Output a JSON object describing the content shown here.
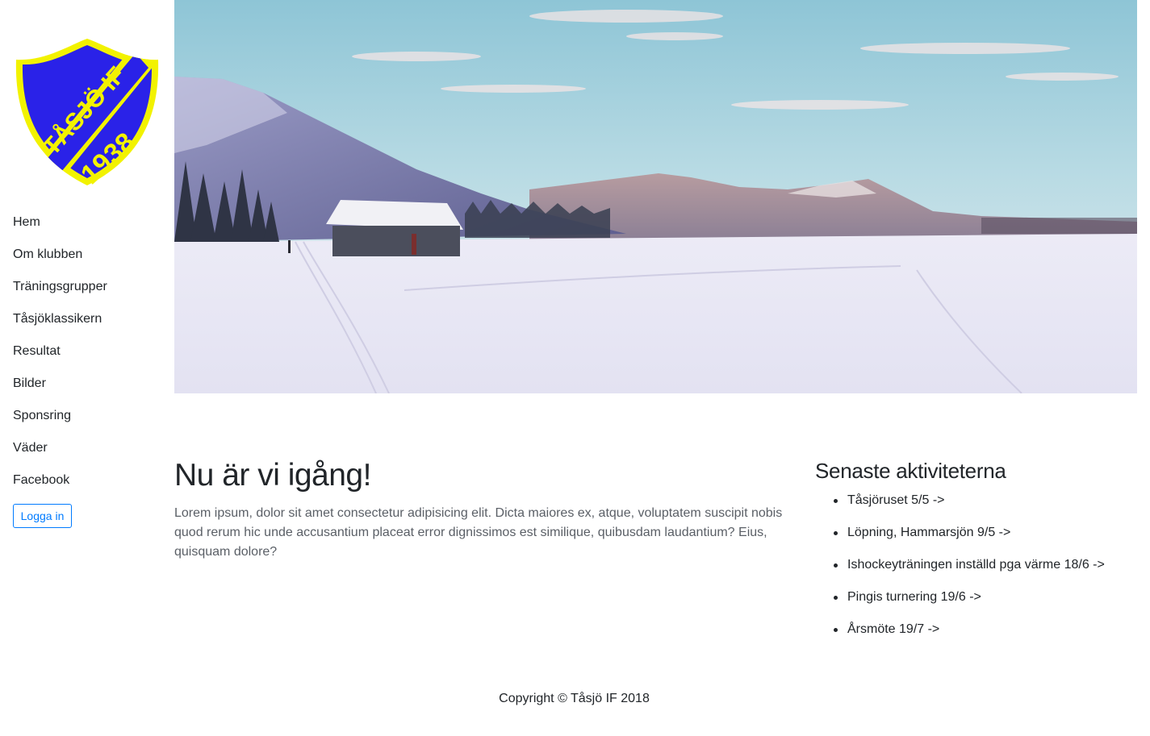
{
  "logo": {
    "club_text": "TÅSJÖ IF",
    "year": "1938"
  },
  "nav": {
    "items": [
      {
        "label": "Hem"
      },
      {
        "label": "Om klubben"
      },
      {
        "label": "Träningsgrupper"
      },
      {
        "label": "Tåsjöklassikern"
      },
      {
        "label": "Resultat"
      },
      {
        "label": "Bilder"
      },
      {
        "label": "Sponsring"
      },
      {
        "label": "Väder"
      },
      {
        "label": "Facebook"
      }
    ],
    "login_label": "Logga in"
  },
  "main": {
    "title": "Nu är vi igång!",
    "text": "Lorem ipsum, dolor sit amet consectetur adipisicing elit. Dicta maiores ex, atque, voluptatem suscipit nobis quod rerum hic unde accusantium placeat error dignissimos est similique, quibusdam laudantium? Eius, quisquam dolore?"
  },
  "aside": {
    "title": "Senaste aktiviteterna",
    "activities": [
      {
        "label": "Tåsjöruset 5/5 ->"
      },
      {
        "label": "Löpning, Hammarsjön 9/5 ->"
      },
      {
        "label": "Ishockeyträningen inställd pga värme 18/6 ->"
      },
      {
        "label": "Pingis turnering 19/6 ->"
      },
      {
        "label": "Årsmöte 19/7 ->"
      }
    ]
  },
  "footer": {
    "copyright": "Copyright © Tåsjö IF 2018"
  },
  "colors": {
    "logo_blue": "#2a22e8",
    "logo_yellow": "#f2f200",
    "link_blue": "#007bff"
  }
}
